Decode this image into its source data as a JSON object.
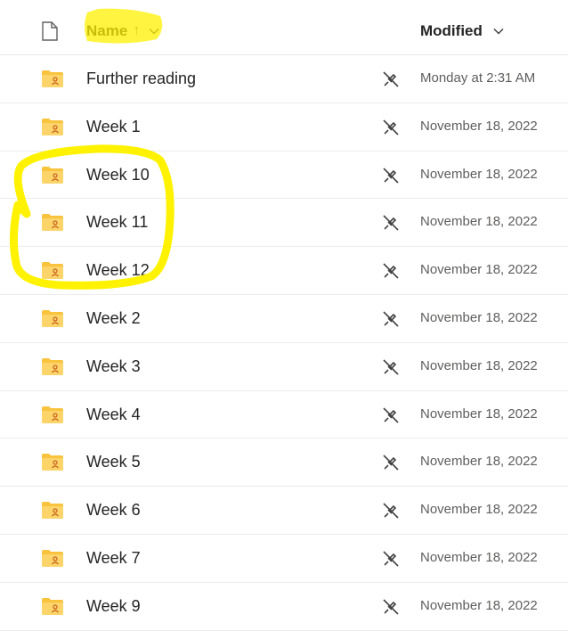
{
  "header": {
    "file_type_icon": "document-icon",
    "name_label": "Name",
    "sort_arrow": "↑",
    "modified_label": "Modified"
  },
  "colors": {
    "folder": "#f9c33e",
    "highlight": "#fff200",
    "text": "#242424",
    "muted": "#605e5c"
  },
  "files": [
    {
      "name": "Further reading",
      "modified": "Monday at 2:31 AM"
    },
    {
      "name": "Week 1",
      "modified": "November 18, 2022"
    },
    {
      "name": "Week 10",
      "modified": "November 18, 2022"
    },
    {
      "name": "Week 11",
      "modified": "November 18, 2022"
    },
    {
      "name": "Week 12",
      "modified": "November 18, 2022"
    },
    {
      "name": "Week 2",
      "modified": "November 18, 2022"
    },
    {
      "name": "Week 3",
      "modified": "November 18, 2022"
    },
    {
      "name": "Week 4",
      "modified": "November 18, 2022"
    },
    {
      "name": "Week 5",
      "modified": "November 18, 2022"
    },
    {
      "name": "Week 6",
      "modified": "November 18, 2022"
    },
    {
      "name": "Week 7",
      "modified": "November 18, 2022"
    },
    {
      "name": "Week 9",
      "modified": "November 18, 2022"
    }
  ]
}
